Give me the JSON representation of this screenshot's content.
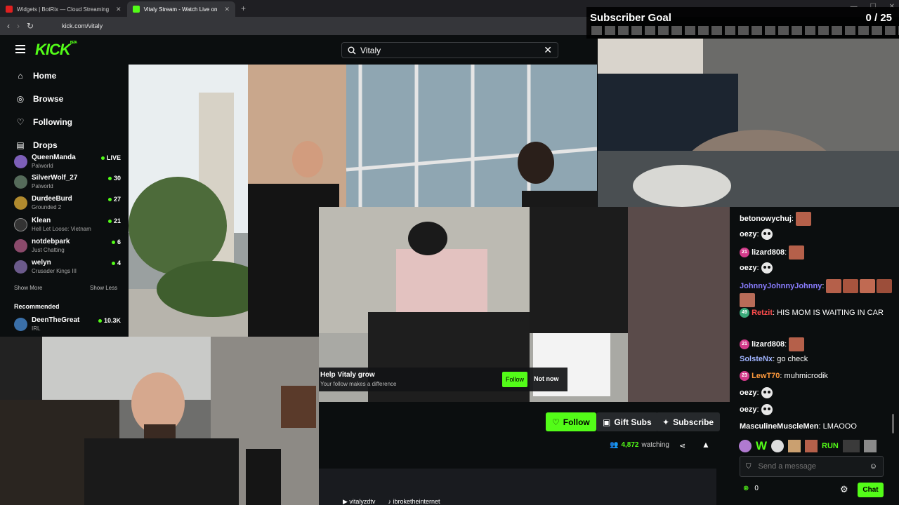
{
  "browser": {
    "tabs": [
      {
        "title": "Widgets | BotRix — Cloud Streaming",
        "favicon_color": "#e02020"
      },
      {
        "title": "Vitaly Stream - Watch Live on",
        "favicon_color": "#53fc18"
      }
    ],
    "url": "kick.com/vitaly"
  },
  "site": {
    "logo": "KICK",
    "logo_badge": "BETA",
    "search_value": "Vitaly",
    "accent": "#53fc18"
  },
  "nav": [
    {
      "label": "Home",
      "icon": "home-icon"
    },
    {
      "label": "Browse",
      "icon": "compass-icon"
    },
    {
      "label": "Following",
      "icon": "heart-icon"
    },
    {
      "label": "Drops",
      "icon": "drops-icon"
    }
  ],
  "following_channels": [
    {
      "name": "QueenManda",
      "game": "Palworld",
      "viewers": "LIVE",
      "color": "#7d5fb8"
    },
    {
      "name": "SilverWolf_27",
      "game": "Palworld",
      "viewers": "30",
      "color": "#556b5a"
    },
    {
      "name": "DurdeeBurd",
      "game": "Grounded 2",
      "viewers": "27",
      "color": "#b08a2e"
    },
    {
      "name": "Klean",
      "game": "Hell Let Loose: Vietnam",
      "viewers": "21",
      "color": "#333"
    },
    {
      "name": "notdebpark",
      "game": "Just Chatting",
      "viewers": "6",
      "color": "#8b4a6b"
    },
    {
      "name": "welyn",
      "game": "Crusader Kings III",
      "viewers": "4",
      "color": "#6b5a8b"
    }
  ],
  "sidebar_links": {
    "show_more": "Show More",
    "show_less": "Show Less",
    "recommended": "Recommended"
  },
  "recommended_channels": [
    {
      "name": "DeenTheGreat",
      "game": "IRL",
      "viewers": "10.3K",
      "color": "#3a6fa8"
    }
  ],
  "follow_prompt": {
    "title": "Help Vitaly grow",
    "subtitle": "Your follow makes a difference",
    "follow": "Follow",
    "not_now": "Not now"
  },
  "actions": {
    "follow": "Follow",
    "gift_subs": "Gift Subs",
    "subscribe": "Subscribe",
    "watching_count": "4,872",
    "watching_label": "watching"
  },
  "social": [
    "vitalyzdtv",
    "ibroketheinternet"
  ],
  "subscriber_goal": {
    "title": "Subscriber Goal",
    "count": "0 / 25",
    "current": 0,
    "target": 25
  },
  "chat": {
    "messages": [
      {
        "user": "betonowychuj",
        "color": "#fff",
        "text": "",
        "emotes": 1,
        "skull": false,
        "badge": null
      },
      {
        "user": "oezy",
        "color": "#fff",
        "text": "",
        "emotes": 0,
        "skull": true,
        "badge": null
      },
      {
        "user": "lizard808",
        "color": "#fff",
        "text": "",
        "emotes": 1,
        "skull": false,
        "badge": "21"
      },
      {
        "user": "oezy",
        "color": "#fff",
        "text": "",
        "emotes": 0,
        "skull": true,
        "badge": null
      },
      {
        "user": "JohnnyJohnnyJohnny",
        "color": "#8a7dff",
        "text": "",
        "emotes": 5,
        "skull": false,
        "badge": null
      },
      {
        "user": "Retzit",
        "color": "#ff4d4d",
        "text": "HIS MOM IS WAITING IN CAR",
        "emotes": 0,
        "skull": false,
        "badge": "49"
      },
      {
        "user": "lizard808",
        "color": "#fff",
        "text": "",
        "emotes": 1,
        "skull": false,
        "badge": "21"
      },
      {
        "user": "SolsteNx",
        "color": "#a0b4ff",
        "text": "go check",
        "emotes": 0,
        "skull": false,
        "badge": null
      },
      {
        "user": "LewT70",
        "color": "#ff9a3c",
        "text": "muhmicrodik",
        "emotes": 0,
        "skull": false,
        "badge": "23"
      },
      {
        "user": "oezy",
        "color": "#fff",
        "text": "",
        "emotes": 0,
        "skull": true,
        "badge": null
      },
      {
        "user": "oezy",
        "color": "#fff",
        "text": "",
        "emotes": 0,
        "skull": true,
        "badge": null
      },
      {
        "user": "MasculineMuscleMen",
        "color": "#fff",
        "text": "LMAOOO",
        "emotes": 0,
        "skull": false,
        "badge": null
      }
    ],
    "emote_bar_run": "RUN",
    "emote_bar_w": "W",
    "input_placeholder": "Send a message",
    "points": "0",
    "chat_button": "Chat"
  }
}
